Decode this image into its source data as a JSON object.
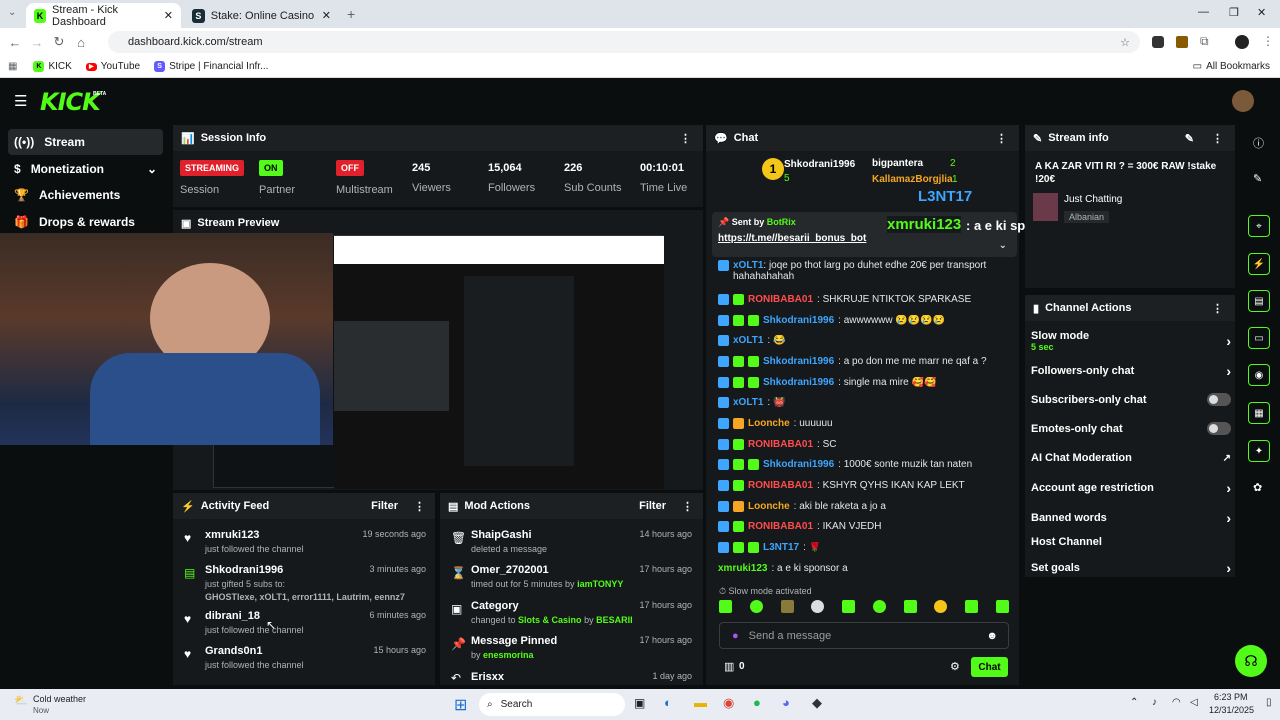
{
  "browser": {
    "tabs": [
      {
        "title": "Stream - Kick Dashboard"
      },
      {
        "title": "Stake: Online Casino & Sports"
      }
    ],
    "url": "dashboard.kick.com/stream",
    "bookmarks": [
      "KICK",
      "YouTube",
      "Stripe | Financial Infr..."
    ],
    "all_bookmarks": "All Bookmarks"
  },
  "kick": {
    "logo": "KICK",
    "beta": "BETA"
  },
  "sidebar": {
    "items": [
      {
        "label": "Stream"
      },
      {
        "label": "Monetization"
      },
      {
        "label": "Achievements"
      },
      {
        "label": "Drops & rewards"
      }
    ]
  },
  "session": {
    "title": "Session Info",
    "stats": [
      {
        "badge": "STREAMING",
        "label": "Session"
      },
      {
        "badge": "ON",
        "label": "Partner Income"
      },
      {
        "badge": "OFF",
        "label": "Multistream"
      },
      {
        "value": "245",
        "label": "Viewers"
      },
      {
        "value": "15,064",
        "label": "Followers"
      },
      {
        "value": "226",
        "label": "Sub Counts"
      },
      {
        "value": "00:10:01",
        "label": "Time Live"
      }
    ]
  },
  "preview": {
    "title": "Stream Preview"
  },
  "activity": {
    "title": "Activity Feed",
    "filter": "Filter",
    "items": [
      {
        "name": "xmruki123",
        "sub": "just followed the channel",
        "time": "19 seconds ago"
      },
      {
        "name": "Shkodrani1996",
        "sub": "just gifted 5 subs to:",
        "extra": "GHOSTlexe, xOLT1, error1111, Lautrim, eennz7",
        "time": "3 minutes ago"
      },
      {
        "name": "dibrani_18",
        "sub": "just followed the channel",
        "time": "6 minutes ago"
      },
      {
        "name": "Grands0n1",
        "sub": "just followed the channel",
        "time": "15 hours ago"
      }
    ]
  },
  "mod": {
    "title": "Mod Actions",
    "filter": "Filter",
    "items": [
      {
        "name": "ShaipGashi",
        "sub": "deleted a message",
        "time": "14 hours ago"
      },
      {
        "name": "Omer_2702001",
        "sub": "timed out for 5 minutes by ",
        "by": "iamTONYY",
        "time": "17 hours ago"
      },
      {
        "name": "Category",
        "sub": "changed to ",
        "cat": "Slots & Casino",
        "mid": " by ",
        "by": "BESARII",
        "time": "17 hours ago"
      },
      {
        "name": "Message Pinned",
        "sub": "by ",
        "by": "enesmorina",
        "time": "17 hours ago"
      },
      {
        "name": "Erisxx",
        "sub": "",
        "time": "1 day ago"
      }
    ]
  },
  "chat": {
    "title": "Chat",
    "top_gifters": {
      "first": "Shkodrani1996",
      "first_count": "5",
      "second": "bigpantera",
      "second_count": "2",
      "third": "KallamazBorgjlia",
      "third_count": "1"
    },
    "pinned": {
      "sent_by": "Sent by",
      "bot": "BotRix",
      "link": "https://t.me//besarii_bonus_bot"
    },
    "overlay_user": "L3NT17",
    "overlay_msg_user": "xmruki123",
    "overlay_msg": ": a e ki sponsor a",
    "messages": [
      {
        "user": "xOLT1",
        "color": "#3ea6ff",
        "text": ": joqe po thot larg po duhet edhe 20€ per transport hahahahahah"
      },
      {
        "user": "RONIBABA01",
        "color": "#ff4d4d",
        "text": ": SHKRUJE NTIKTOK SPARKASE"
      },
      {
        "user": "Shkodrani1996",
        "color": "#3ea6ff",
        "text": ": awwwwww 😢😢😢😢"
      },
      {
        "user": "xOLT1",
        "color": "#3ea6ff",
        "text": ": 😂"
      },
      {
        "user": "Shkodrani1996",
        "color": "#3ea6ff",
        "text": ": a po don me me marr ne qaf a ?"
      },
      {
        "user": "Shkodrani1996",
        "color": "#3ea6ff",
        "text": ": single ma mire 🥰🥰"
      },
      {
        "user": "xOLT1",
        "color": "#3ea6ff",
        "text": ": 👹"
      },
      {
        "user": "Loonche",
        "color": "#f5a623",
        "text": ": uuuuuu"
      },
      {
        "user": "RONIBABA01",
        "color": "#ff4d4d",
        "text": ": SC"
      },
      {
        "user": "Shkodrani1996",
        "color": "#3ea6ff",
        "text": ": 1000€ sonte muzik tan naten"
      },
      {
        "user": "RONIBABA01",
        "color": "#ff4d4d",
        "text": ": KSHYR QYHS IKAN KAP LEKT"
      },
      {
        "user": "Loonche",
        "color": "#f5a623",
        "text": ": aki ble raketa a jo a"
      },
      {
        "user": "RONIBABA01",
        "color": "#ff4d4d",
        "text": ": IKAN VJEDH"
      },
      {
        "user": "L3NT17",
        "color": "#3ea6ff",
        "text": ": 🌹"
      },
      {
        "user": "xmruki123",
        "color": "#53fc18",
        "text": ": a e ki sponsor a"
      }
    ],
    "slow_mode": "Slow mode activated",
    "placeholder": "Send a message",
    "count": "0",
    "send": "Chat"
  },
  "stream_info": {
    "title": "Stream info",
    "stream_title": "A KA ZAR VITI RI ? = 300€ RAW !stake !20€",
    "category": "Just Chatting",
    "language": "Albanian"
  },
  "channel_actions": {
    "title": "Channel Actions",
    "items": [
      {
        "label": "Slow mode",
        "sub": "5 sec",
        "ctl": "chevron"
      },
      {
        "label": "Followers-only chat",
        "ctl": "chevron"
      },
      {
        "label": "Subscribers-only chat",
        "ctl": "toggle"
      },
      {
        "label": "Emotes-only chat",
        "ctl": "toggle"
      },
      {
        "label": "AI Chat Moderation",
        "ctl": "external"
      },
      {
        "label": "Account age restriction",
        "ctl": "chevron"
      },
      {
        "label": "Banned words",
        "ctl": "chevron"
      },
      {
        "label": "Host Channel",
        "ctl": "none"
      },
      {
        "label": "Set goals",
        "ctl": "chevron"
      }
    ]
  },
  "taskbar": {
    "weather": "Cold weather",
    "weather_sub": "Now",
    "search": "Search",
    "time": "6:23 PM",
    "date": "12/31/2025"
  },
  "colors": {
    "accent": "#53fc18",
    "panel": "#16191b",
    "bg": "#0b0e0f"
  }
}
